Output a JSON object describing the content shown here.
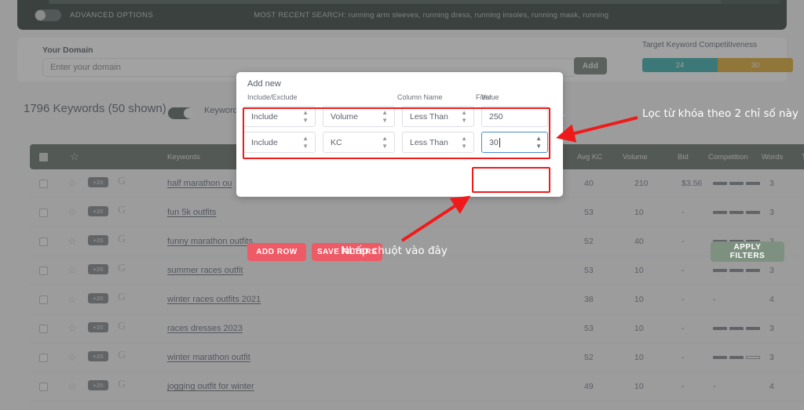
{
  "topbar": {
    "advanced_options_label": "ADVANCED OPTIONS",
    "advanced_toggle_state": "off",
    "recent_search_label": "MOST RECENT SEARCH: running arm sleeves, running dress, running insoles, running mask, running"
  },
  "domain": {
    "label": "Your Domain",
    "input_value": "",
    "input_placeholder": "Enter your domain",
    "add_button": "Add"
  },
  "target_keyword": {
    "title": "Target Keyword Competitiveness",
    "segments": [
      {
        "label": "24",
        "color": "#17a0a0"
      },
      {
        "label": "30",
        "color": "#d99b14"
      }
    ]
  },
  "keywords_header": {
    "count_label": "1796 Keywords (50 shown)",
    "toggle_state": "on",
    "sub_label": "Keyword"
  },
  "table": {
    "columns": [
      "Keywords",
      "Avg KC",
      "Volume",
      "Bid",
      "Competition",
      "Words",
      "Ti"
    ],
    "rows": [
      {
        "badge": "+20",
        "keyword": "half marathon ou",
        "avg_kc": "40",
        "volume": "210",
        "bid": "$3.56",
        "competition": "bars-3",
        "words": "3"
      },
      {
        "badge": "+20",
        "keyword": "fun 5k outfits",
        "avg_kc": "53",
        "volume": "10",
        "bid": "-",
        "competition": "bars-3",
        "words": "3"
      },
      {
        "badge": "+20",
        "keyword": "funny marathon outfits",
        "avg_kc": "52",
        "volume": "40",
        "bid": "-",
        "competition": "bars-3",
        "words": "3"
      },
      {
        "badge": "+20",
        "keyword": "summer races outfit",
        "avg_kc": "53",
        "volume": "10",
        "bid": "-",
        "competition": "bars-3",
        "words": "3"
      },
      {
        "badge": "+20",
        "keyword": "winter races outfits 2021",
        "avg_kc": "38",
        "volume": "10",
        "bid": "-",
        "competition": "-",
        "words": "4"
      },
      {
        "badge": "+20",
        "keyword": "races dresses 2023",
        "avg_kc": "53",
        "volume": "10",
        "bid": "-",
        "competition": "bars-3",
        "words": "3"
      },
      {
        "badge": "+20",
        "keyword": "winter marathon outfit",
        "avg_kc": "52",
        "volume": "10",
        "bid": "-",
        "competition": "bars-2",
        "words": "3"
      },
      {
        "badge": "+20",
        "keyword": "jogging outfit for winter",
        "avg_kc": "49",
        "volume": "10",
        "bid": "-",
        "competition": "-",
        "words": "4"
      }
    ]
  },
  "modal": {
    "title": "Add new",
    "column_labels": {
      "include_exclude": "Include/Exclude",
      "column_name": "Column Name",
      "filter": "Filter",
      "value": "Value"
    },
    "rows": [
      {
        "include_exclude": "Include",
        "column_name": "Volume",
        "filter": "Less Than",
        "value": "250",
        "remove": "×"
      },
      {
        "include_exclude": "Include",
        "column_name": "KC",
        "filter": "Less Than",
        "value": "30",
        "remove": "×"
      }
    ],
    "buttons": {
      "add_row": "ADD ROW",
      "save_filters": "SAVE FILTERS",
      "apply_filters": "APPLY FILTERS"
    }
  },
  "annotations": {
    "filter_note": "Lọc từ khóa theo 2 chỉ số này",
    "click_note": "Nhấp chuột vào đây",
    "highlight_color": "#ef1b1b"
  }
}
